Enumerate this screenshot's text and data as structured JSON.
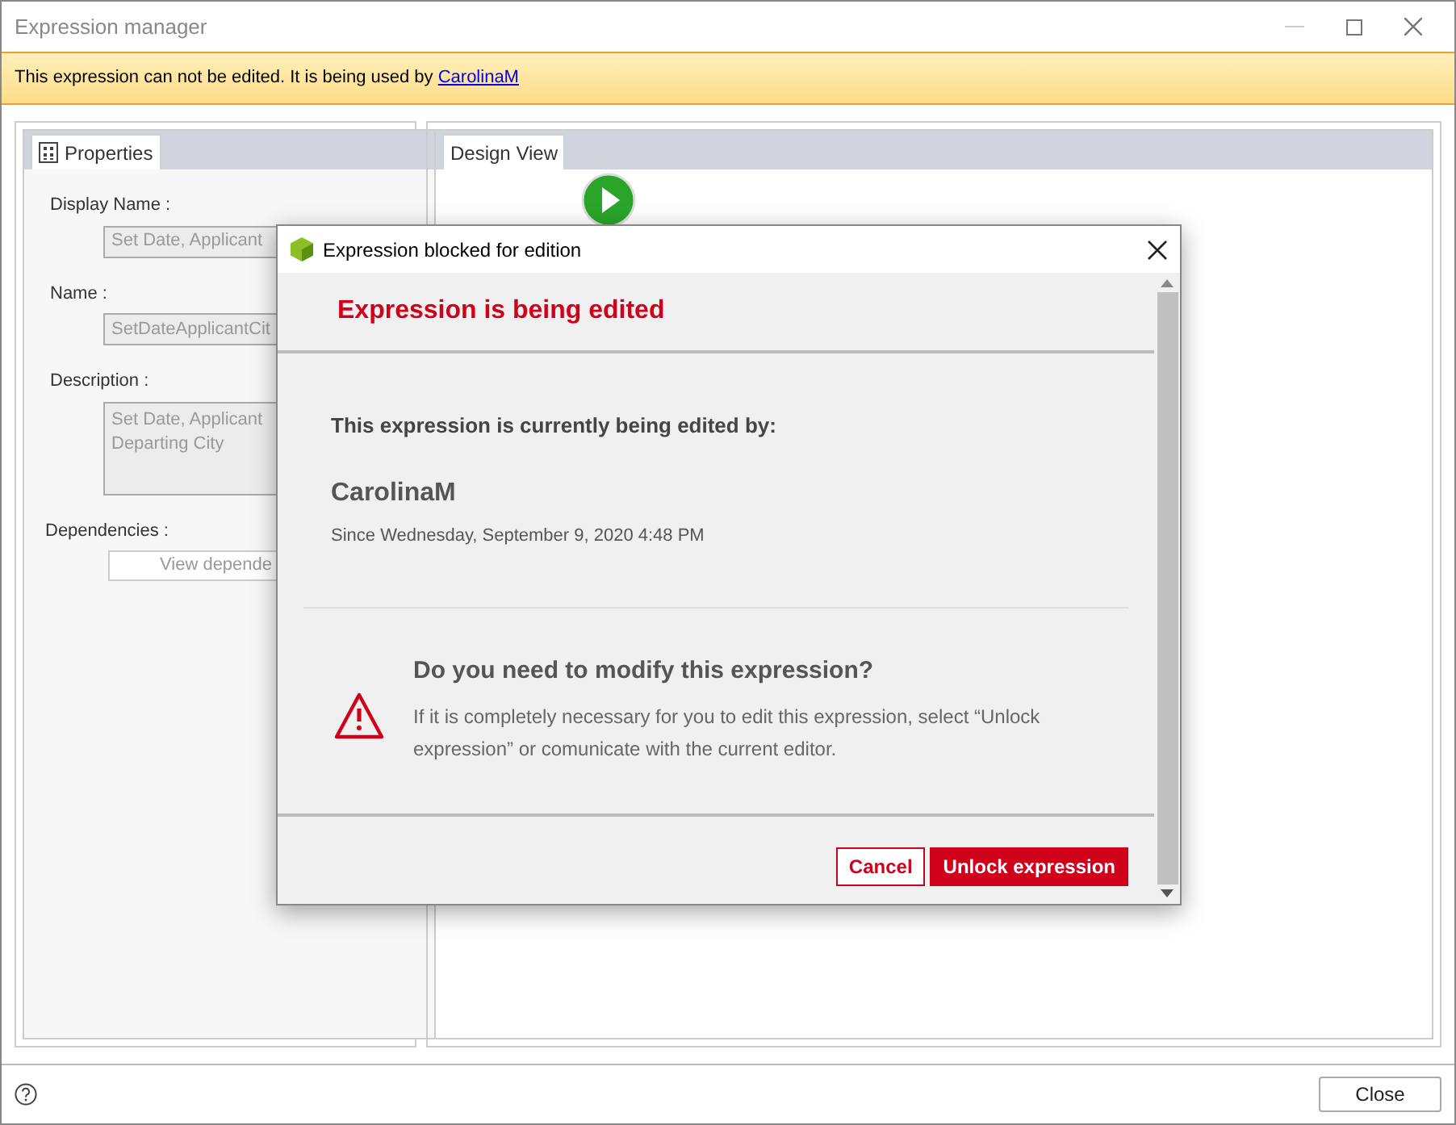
{
  "window": {
    "title": "Expression manager"
  },
  "banner": {
    "text": "This expression can not be edited. It is being used by",
    "link": "CarolinaM"
  },
  "properties": {
    "tab": {
      "label": "Properties",
      "selected": true
    },
    "fields": [
      {
        "label": "Display Name :",
        "lines": [
          "Set Date, Applicant"
        ]
      },
      {
        "label": "Name :",
        "lines": [
          "SetDateApplicantCit"
        ]
      },
      {
        "label": "Description :",
        "lines": [
          "Set Date, Applicant",
          "Departing City"
        ],
        "kind": "multiline"
      }
    ],
    "dependencies": {
      "label": "Dependencies :",
      "button": "View depende"
    }
  },
  "design": {
    "tab": {
      "label": "Design View",
      "selected": true
    }
  },
  "dialog": {
    "title": "Expression blocked for edition",
    "heading": "Expression is being edited",
    "intro": "This expression is currently being edited by:",
    "user": "CarolinaM",
    "since": "Since Wednesday, September 9, 2020 4:48 PM",
    "question": "Do you need to modify this expression?",
    "advice": "If it is completely necessary for you to edit this expression, select “Unlock expression” or comunicate with the current editor.",
    "buttons": [
      {
        "label": "Cancel",
        "kind": "secondary"
      },
      {
        "label": "Unlock expression",
        "kind": "primary"
      }
    ]
  },
  "footer": {
    "button": "Close"
  }
}
